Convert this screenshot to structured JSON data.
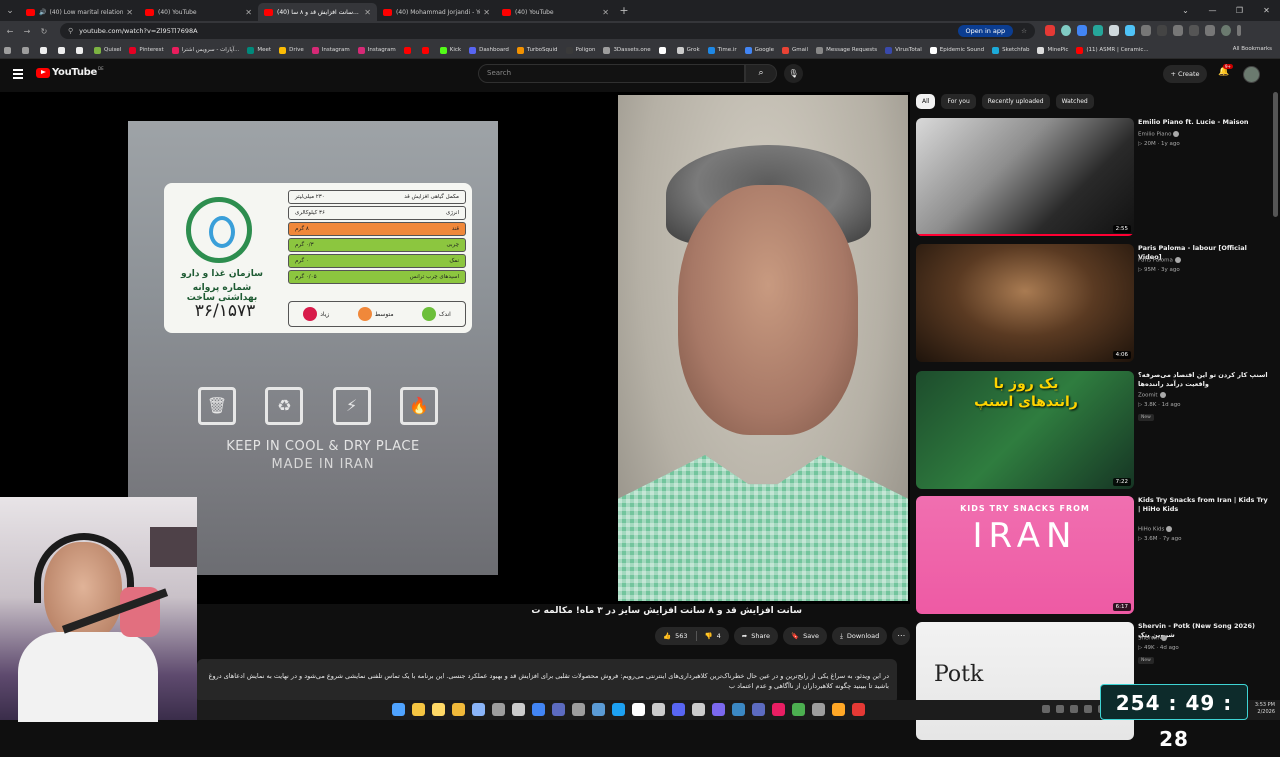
{
  "browser": {
    "tabs": [
      {
        "title": "(40) Low marital relationshi...",
        "active": false,
        "muted": true
      },
      {
        "title": "(40) YouTube",
        "active": false,
        "muted": false
      },
      {
        "title": "(40) سانت افزایش قد و ۸ سا...",
        "active": true,
        "muted": false
      },
      {
        "title": "(40) Mohammad Jorjandi - You...",
        "active": false,
        "muted": false
      },
      {
        "title": "(40) YouTube",
        "active": false,
        "muted": false
      }
    ],
    "url": "youtube.com/watch?v=Zl95Tl7698A",
    "open_in_app": "Open in app",
    "bookmarks": [
      {
        "label": "Quixel",
        "color": "#7cb342"
      },
      {
        "label": "Pinterest",
        "color": "#e60023"
      },
      {
        "label": "آپارات - سرویس اشترا...",
        "color": "#ea1d5d"
      },
      {
        "label": "Meet",
        "color": "#00897b"
      },
      {
        "label": "Drive",
        "color": "#fbbc04"
      },
      {
        "label": "Instagram",
        "color": "#d62976"
      },
      {
        "label": "Instagram",
        "color": "#d62976"
      },
      {
        "label": "",
        "color": "#ff0000"
      },
      {
        "label": "",
        "color": "#ff0000"
      },
      {
        "label": "Kick",
        "color": "#53fc18"
      },
      {
        "label": "Dashboard",
        "color": "#5865f2"
      },
      {
        "label": "TurboSquid",
        "color": "#f39200"
      },
      {
        "label": "Poligon",
        "color": "#3a3a3a"
      },
      {
        "label": "3Dassets.one",
        "color": "#9e9e9e"
      },
      {
        "label": "",
        "color": "#ffffff"
      },
      {
        "label": "Grok",
        "color": "#cccccc"
      },
      {
        "label": "Time.ir",
        "color": "#1e88e5"
      },
      {
        "label": "Google",
        "color": "#4285f4"
      },
      {
        "label": "Gmail",
        "color": "#ea4335"
      },
      {
        "label": "Message Requests",
        "color": "#888888"
      },
      {
        "label": "VirusTotal",
        "color": "#3949ab"
      },
      {
        "label": "Epidemic Sound",
        "color": "#ffffff"
      },
      {
        "label": "Sketchfab",
        "color": "#1caad9"
      },
      {
        "label": "MinePic",
        "color": "#dddddd"
      },
      {
        "label": "(11) ASMR | Ceramic...",
        "color": "#ff0000"
      }
    ],
    "all_bookmarks": "All Bookmarks"
  },
  "youtube": {
    "logo_text": "YouTube",
    "country_code": "DE",
    "search_placeholder": "Search",
    "create_label": "Create",
    "notif_count": "9+"
  },
  "video": {
    "label_brand_line1": "سازمان غذا و دارو",
    "label_brand_line2": "شماره پروانه بهداشتی ساخت",
    "license_number": "۳۶/۱۵۷۳",
    "nutrition_rows": [
      {
        "name": "مکمل گیاهی افزایش قد",
        "value": "۲۳۰ میلی‌لیتر",
        "color": "#f5f6f2"
      },
      {
        "name": "انرژی",
        "value": "۳۶ کیلوکالری",
        "color": "#f5f6f2"
      },
      {
        "name": "قند",
        "value": "۸ گرم",
        "color": "#f0883a"
      },
      {
        "name": "چربی",
        "value": "۰/۳ گرم",
        "color": "#8cc63f"
      },
      {
        "name": "نمک",
        "value": "۰ گرم",
        "color": "#8cc63f"
      },
      {
        "name": "اسیدهای چرب ترانس",
        "value": "۰/۰۵ گرم",
        "color": "#8cc63f"
      }
    ],
    "levels": [
      {
        "name": "اندک",
        "color": "#6cbf3a"
      },
      {
        "name": "متوسط",
        "color": "#f0883a"
      },
      {
        "name": "زیاد",
        "color": "#d81b4a"
      }
    ],
    "keep_text": "KEEP IN COOL & DRY PLACE",
    "made_text": "MADE IN IRAN",
    "title": "سانت افزایش قد و ۸ سانت افزایش سایز در ۳ ماه! مکالمه ت",
    "likes": "563",
    "dislikes": "4",
    "share": "Share",
    "save": "Save",
    "download": "Download",
    "description_line1": "در این ویدئو، به سراغ یکی از رایج‌ترین و در عین حال خطرناک‌ترین کلاهبرداری‌های اینترنتی می‌رویم: فروش محصولات تقلبی برای افزایش قد و بهبود عملکرد جنسی. این برنامه با یک تماس تلفنی نمایشی شروع می‌شود و در نهایت به نمایش ادعاهای دروغ",
    "description_line2": "باشید تا ببینید چگونه کلاهبرداران از ناآگاهی و عدم اعتماد ب"
  },
  "sidebar": {
    "chips": [
      {
        "label": "All",
        "active": true
      },
      {
        "label": "For you",
        "active": false
      },
      {
        "label": "Recently uploaded",
        "active": false
      },
      {
        "label": "Watched",
        "active": false
      }
    ],
    "recommendations": [
      {
        "title": "Emilio Piano ft. Lucie - Maison",
        "channel": "Emilio Piano",
        "meta": "20M · 1y ago",
        "duration": "2:55",
        "badge": "",
        "progress": 1.0,
        "thumb": "linear-gradient(135deg,#d9d9d9 0%,#8e8e8e 40%,#2a2a2a 70%,#111 100%)"
      },
      {
        "title": "Paris Paloma - labour [Official Video]",
        "channel": "Paris Paloma",
        "meta": "95M · 3y ago",
        "duration": "4:06",
        "badge": "",
        "progress": 0.0,
        "thumb": "radial-gradient(ellipse at 50% 40%,#a97b52 0%,#5a3a22 45%,#1e130b 100%)"
      },
      {
        "title": "اسنپ کار کردن تو این اقتصاد می‌صرفه؟ واقعیت درآمد راننده‌ها",
        "channel": "Zoomit",
        "meta": "3.8K · 1d ago",
        "duration": "7:22",
        "badge": "New",
        "progress": 0.0,
        "thumb": "linear-gradient(135deg,#1d4c2c 0%,#2f7d3f 50%,#163524 100%)"
      },
      {
        "title": "Kids Try Snacks from Iran | Kids Try | HiHo Kids",
        "channel": "HiHo Kids",
        "meta": "3.6M · 7y ago",
        "duration": "6:17",
        "badge": "",
        "progress": 0.0,
        "thumb": "linear-gradient(180deg,#f06fb0 0%,#ee5aa4 100%)"
      },
      {
        "title": "Shervin - Potk (New Song 2026) شروین پتک",
        "channel": "Shervin",
        "meta": "49K · 4d ago",
        "duration": "",
        "badge": "New",
        "progress": 0.0,
        "thumb": "linear-gradient(180deg,#f2f2f2 0%,#e6e6e6 100%)"
      }
    ],
    "snapp_overlay": "یک روز با رانندهای اسنپ",
    "kids_overlay_top": "KIDS TRY SNACKS FROM",
    "kids_overlay_big": "IRAN",
    "potk_overlay": "Potk"
  },
  "stream": {
    "timer": "254 : 49 : 28"
  },
  "taskbar": {
    "time": "3:53 PM",
    "date": "2/2026",
    "icon_colors": [
      "#4fa3ff",
      "#f5c542",
      "#ffd966",
      "#f0b93a",
      "#8ab4f8",
      "#9e9e9e",
      "#cccccc",
      "#4285f4",
      "#5c6bc0",
      "#9e9e9e",
      "#5b9bd5",
      "#1da1f2",
      "#ffffff",
      "#cccccc",
      "#5865f2",
      "#cccccc",
      "#7b68ee",
      "#3b88c3",
      "#5c6bc0",
      "#e91e63",
      "#4caf50",
      "#9e9e9e",
      "#ffa726",
      "#e53935"
    ]
  }
}
